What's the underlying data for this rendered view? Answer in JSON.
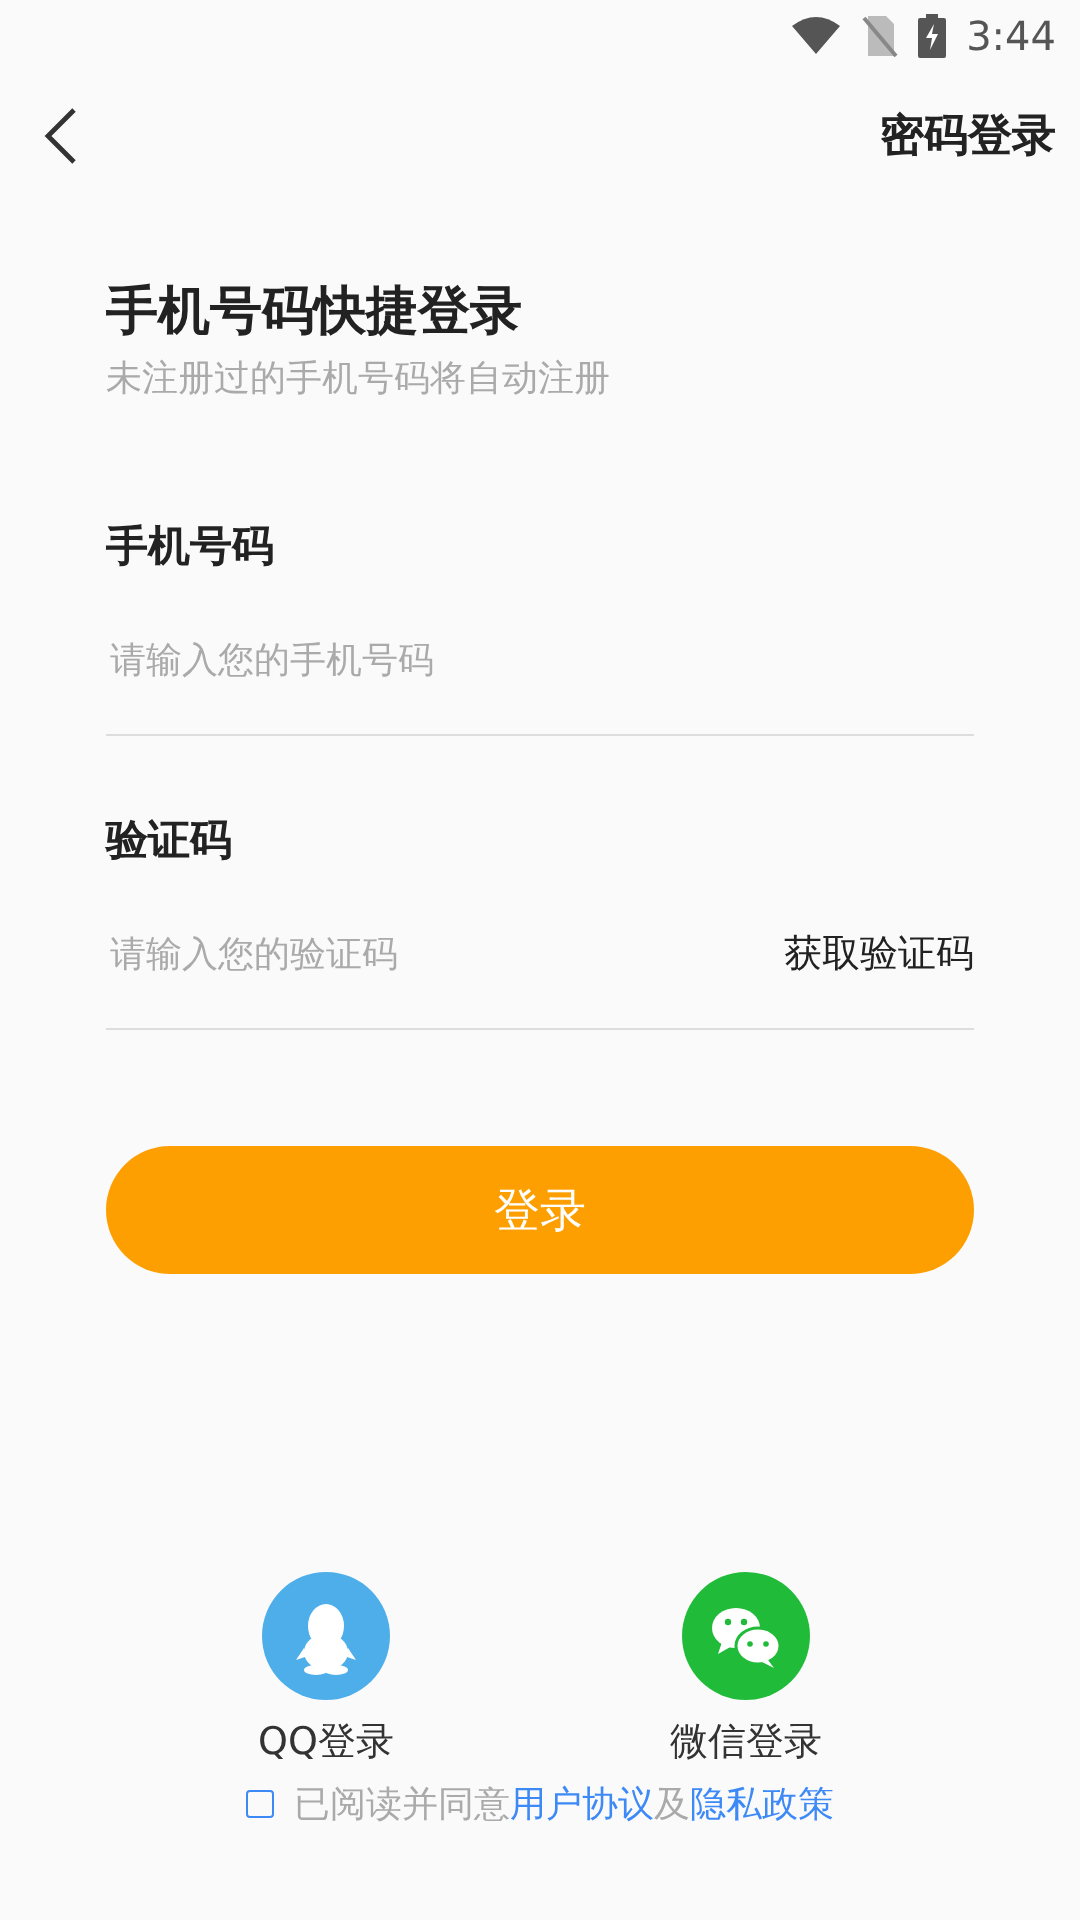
{
  "status_bar": {
    "time": "3:44"
  },
  "header": {
    "switch_link": "密码登录"
  },
  "title": "手机号码快捷登录",
  "subtitle": "未注册过的手机号码将自动注册",
  "fields": [
    {
      "label": "手机号码",
      "placeholder": "请输入您的手机号码"
    },
    {
      "label": "验证码",
      "placeholder": "请输入您的验证码",
      "action": "获取验证码"
    }
  ],
  "login_button": "登录",
  "social": [
    {
      "kind": "qq",
      "label": "QQ登录",
      "color": "#4eaeea"
    },
    {
      "kind": "wechat",
      "label": "微信登录",
      "color": "#21bb3a"
    }
  ],
  "agreement": {
    "checked": false,
    "prefix": "已阅读并同意",
    "link_1": "用户协议",
    "middle": "及",
    "link_2": "隐私政策"
  }
}
